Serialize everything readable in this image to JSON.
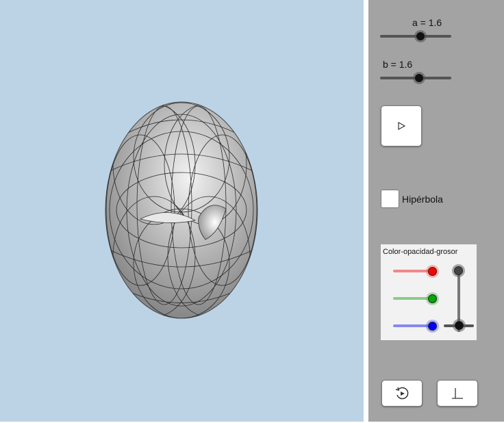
{
  "sliders": [
    {
      "label": "a = 1.6",
      "value": 1.6
    },
    {
      "label": "b = 1.6",
      "value": 1.6
    }
  ],
  "play_button": {
    "icon": "play-icon"
  },
  "checkbox": {
    "label": "Hipérbola",
    "checked": false
  },
  "color_panel": {
    "title": "Color-opacidad-grosor",
    "red_color": "#ff0000",
    "green_color": "#00aa00",
    "blue_color": "#0000ff"
  },
  "bottom_buttons": [
    {
      "icon": "reset-icon"
    },
    {
      "icon": "axes-icon"
    }
  ],
  "colors": {
    "view_background": "#bcd3e6",
    "panel_background": "#a3a3a3",
    "surface": "#b5b5b5"
  }
}
